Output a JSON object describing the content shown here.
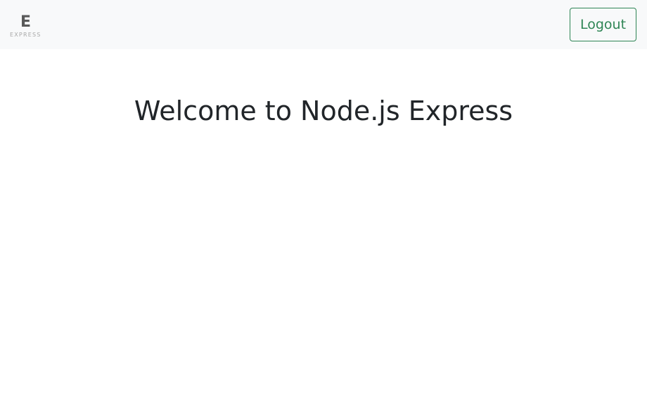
{
  "header": {
    "logo": {
      "letter": "E",
      "wordmark": "EXPRESS"
    },
    "logout_label": "Logout"
  },
  "main": {
    "title": "Welcome to Node.js Express"
  },
  "colors": {
    "navbar_bg": "#f8f9fa",
    "accent": "#2e8555",
    "text": "#212529"
  }
}
